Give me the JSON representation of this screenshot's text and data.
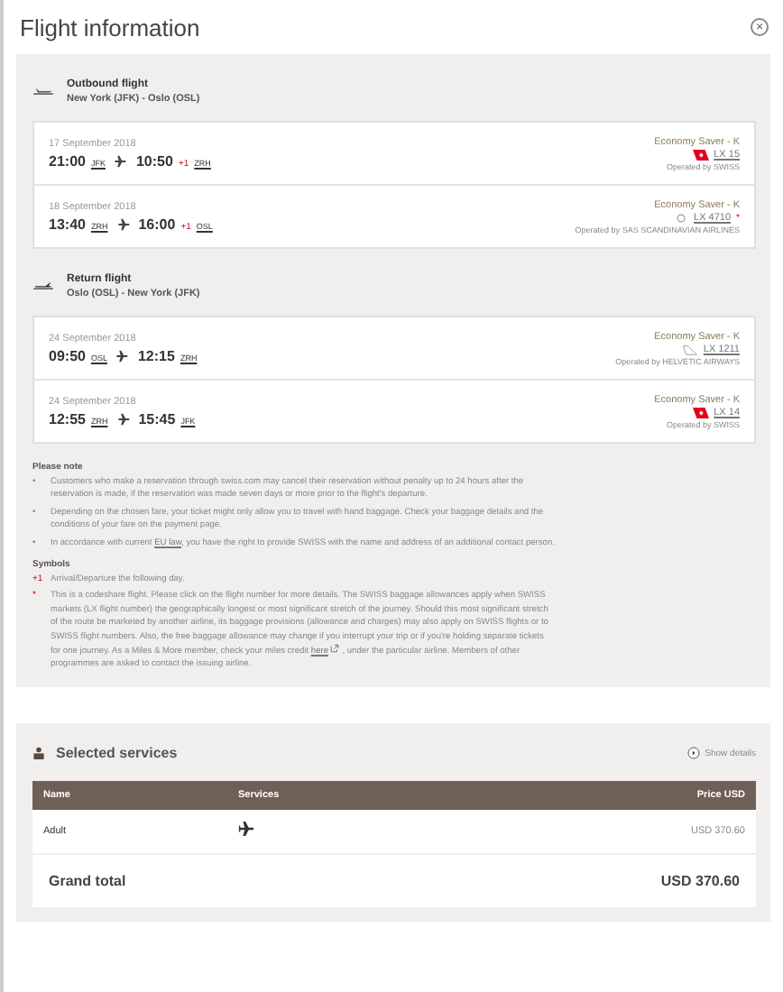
{
  "title": "Flight information",
  "close": "×",
  "journeys": [
    {
      "kind": "outbound",
      "title": "Outbound flight",
      "route": "New York (JFK) - Oslo (OSL)",
      "flights": [
        {
          "date": "17 September 2018",
          "dep_time": "21:00",
          "dep_airport": "JFK",
          "arr_time": "10:50",
          "next_day": "+1",
          "arr_airport": "ZRH",
          "fare": "Economy Saver - K",
          "kind": "swiss",
          "flight_number": "LX 15",
          "operated_by": "Operated by SWISS"
        },
        {
          "date": "18 September 2018",
          "dep_time": "13:40",
          "dep_airport": "ZRH",
          "arr_time": "16:00",
          "next_day": "+1",
          "arr_airport": "OSL",
          "fare": "Economy Saver - K",
          "kind": "sas",
          "flight_number": "LX 4710",
          "codeshare": "*",
          "operated_by": "Operated by SAS SCANDINAVIAN AIRLINES"
        }
      ]
    },
    {
      "kind": "return",
      "title": "Return flight",
      "route": "Oslo (OSL) - New York (JFK)",
      "flights": [
        {
          "date": "24 September 2018",
          "dep_time": "09:50",
          "dep_airport": "OSL",
          "arr_time": "12:15",
          "arr_airport": "ZRH",
          "fare": "Economy Saver - K",
          "kind": "helvetic",
          "flight_number": "LX 1211",
          "operated_by": "Operated by HELVETIC AIRWAYS"
        },
        {
          "date": "24 September 2018",
          "dep_time": "12:55",
          "dep_airport": "ZRH",
          "arr_time": "15:45",
          "arr_airport": "JFK",
          "fare": "Economy Saver - K",
          "kind": "swiss",
          "flight_number": "LX 14",
          "operated_by": "Operated by SWISS"
        }
      ]
    }
  ],
  "notes": {
    "title": "Please note",
    "bullet": "•",
    "items": [
      [
        {
          "kind": "text",
          "text": "Customers who make a reservation through swiss.com may cancel their reservation without penalty up to 24 hours after the reservation is made, if the reservation was made seven days or more prior to the flight's departure."
        }
      ],
      [
        {
          "kind": "text",
          "text": "Depending on the chosen fare, your ticket might only allow you to travel with hand baggage. Check your baggage details and the conditions of your fare on the payment page."
        }
      ],
      [
        {
          "kind": "text",
          "text": "In accordance with current "
        },
        {
          "kind": "link",
          "text": "EU law"
        },
        {
          "kind": "text",
          "text": ", you have the right to provide SWISS with the name and address of an additional contact person."
        }
      ]
    ]
  },
  "symbols": {
    "title": "Symbols",
    "items": [
      {
        "symbol": "+1",
        "parts": [
          {
            "kind": "text",
            "text": "Arrival/Departure the following day."
          }
        ]
      },
      {
        "symbol": "*",
        "parts": [
          {
            "kind": "text",
            "text": "This is a codeshare flight. Please click on the flight number for more details. The SWISS baggage allowances apply when SWISS markets (LX flight number) the geographically longest or most significant stretch of the journey. Should this most significant stretch of the route be marketed by another airline, its baggage provisions (allowance and charges) may also apply on SWISS flights or to SWISS flight numbers. Also, the free baggage allowance may change if you interrupt your trip or if you're holding separate tickets for one journey. As a Miles & More member, check your miles credit "
          },
          {
            "kind": "extlink",
            "text": "here"
          },
          {
            "kind": "text",
            "text": " , under the particular airline. Members of other programmes are asked to contact the issuing airline."
          }
        ]
      }
    ]
  },
  "services": {
    "title": "Selected services",
    "show_details": "Show details",
    "columns": [
      "Name",
      "Services",
      "Price USD"
    ],
    "rows": [
      {
        "name": "Adult",
        "kind": "flight",
        "price": "USD  370.60"
      }
    ],
    "total_label": "Grand total",
    "total": "USD  370.60"
  }
}
